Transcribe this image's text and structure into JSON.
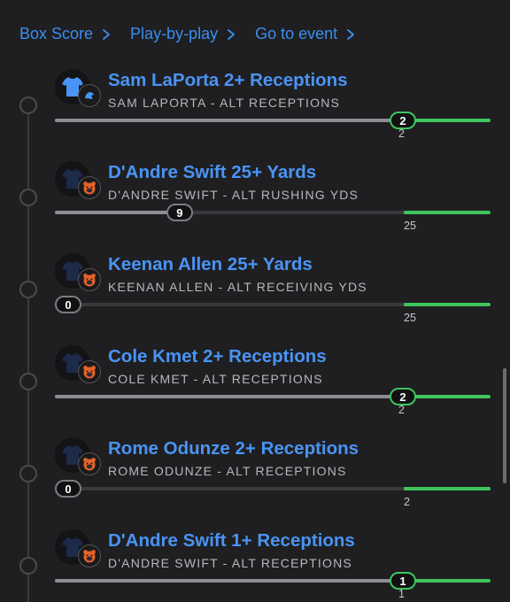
{
  "breadcrumb": [
    {
      "label": "Box Score"
    },
    {
      "label": "Play-by-play"
    },
    {
      "label": "Go to event"
    }
  ],
  "colors": {
    "link": "#4a94f5",
    "hit": "#3fc55e",
    "progress": "#8e8e92",
    "track": "#3a3a3d"
  },
  "legs": [
    {
      "title": "Sam LaPorta 2+ Receptions",
      "subtitle": "SAM LAPORTA - ALT RECEPTIONS",
      "current": "2",
      "target": "2",
      "progress": 1.0,
      "hit": true,
      "team_icon": "lions-logo-icon"
    },
    {
      "title": "D'Andre Swift 25+ Yards",
      "subtitle": "D'ANDRE SWIFT - ALT RUSHING YDS",
      "current": "9",
      "target": "25",
      "progress": 0.36,
      "hit": false,
      "team_icon": "bears-logo-icon"
    },
    {
      "title": "Keenan Allen 25+ Yards",
      "subtitle": "KEENAN ALLEN - ALT RECEIVING YDS",
      "current": "0",
      "target": "25",
      "progress": 0.0,
      "hit": false,
      "team_icon": "bears-logo-icon"
    },
    {
      "title": "Cole Kmet 2+ Receptions",
      "subtitle": "COLE KMET - ALT RECEPTIONS",
      "current": "2",
      "target": "2",
      "progress": 1.0,
      "hit": true,
      "team_icon": "bears-logo-icon"
    },
    {
      "title": "Rome Odunze 2+ Receptions",
      "subtitle": "ROME ODUNZE - ALT RECEPTIONS",
      "current": "0",
      "target": "2",
      "progress": 0.0,
      "hit": false,
      "team_icon": "bears-logo-icon"
    },
    {
      "title": "D'Andre Swift 1+ Receptions",
      "subtitle": "D'ANDRE SWIFT - ALT RECEPTIONS",
      "current": "1",
      "target": "1",
      "progress": 1.0,
      "hit": true,
      "team_icon": "bears-logo-icon"
    }
  ]
}
